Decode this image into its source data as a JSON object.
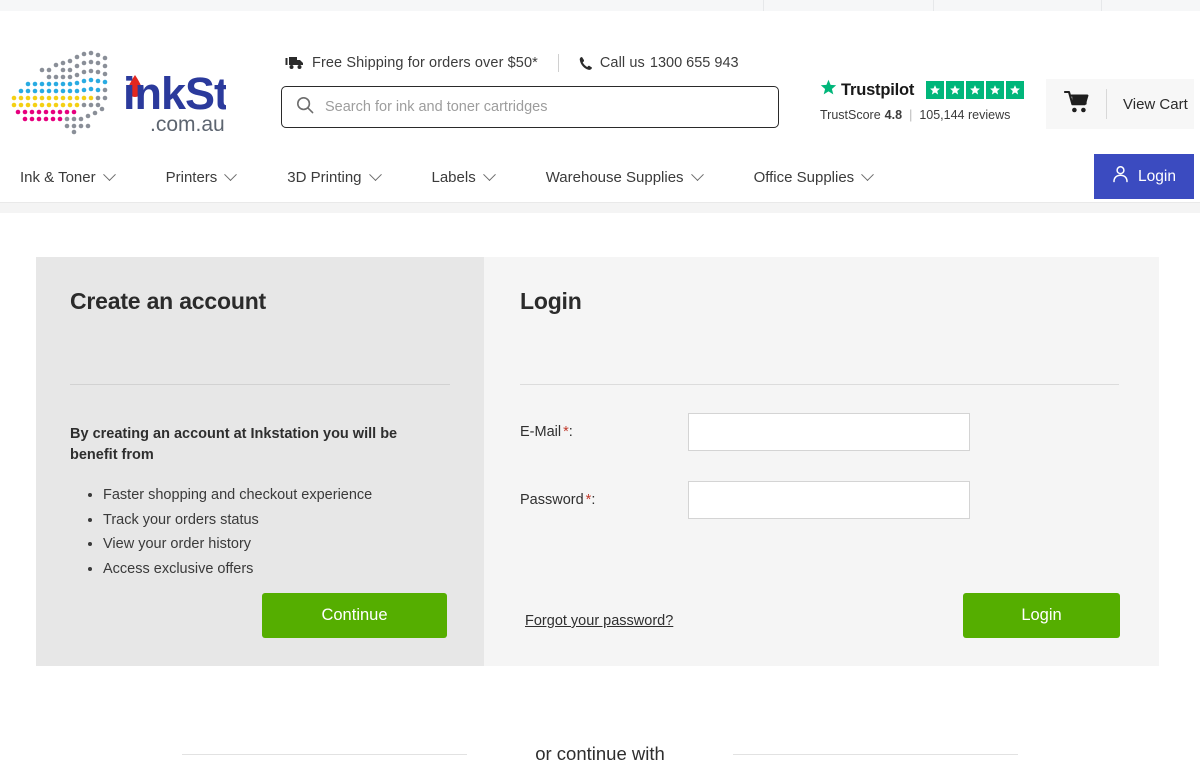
{
  "top_strip": {
    "segments": 4
  },
  "header": {
    "logo": {
      "name": "inkstation-logo",
      "text_ink": "ink",
      "text_station": "Station",
      "text_domain": ".com.au"
    },
    "shipping": {
      "icon": "truck-icon",
      "text": "Free Shipping for orders over $50*"
    },
    "phone": {
      "icon": "phone-icon",
      "label": "Call us",
      "number": "1300 655 943"
    },
    "search": {
      "icon": "search-icon",
      "placeholder": "Search for ink and toner cartridges",
      "value": ""
    },
    "trustpilot": {
      "name": "Trustpilot",
      "stars": 5,
      "star_color": "#00b67a",
      "score_label": "TrustScore",
      "score_value": "4.8",
      "divider": "|",
      "reviews": "105,144 reviews"
    },
    "cart": {
      "icon": "shopping-cart-icon",
      "label": "View Cart"
    }
  },
  "nav": {
    "items": [
      {
        "label": "Ink & Toner",
        "has_dropdown": true
      },
      {
        "label": "Printers",
        "has_dropdown": true
      },
      {
        "label": "3D Printing",
        "has_dropdown": true
      },
      {
        "label": "Labels",
        "has_dropdown": true
      },
      {
        "label": "Warehouse Supplies",
        "has_dropdown": true
      },
      {
        "label": "Office Supplies",
        "has_dropdown": true
      }
    ],
    "login_button": {
      "label": "Login",
      "icon": "user-icon",
      "color": "#3b4bc0"
    }
  },
  "main": {
    "create_account": {
      "title": "Create an account",
      "subtitle": "By creating an account at Inkstation you will be benefit from",
      "benefits": [
        "Faster shopping and checkout experience",
        "Track your orders status",
        "View your order history",
        "Access exclusive offers"
      ],
      "continue_button": "Continue"
    },
    "login": {
      "title": "Login",
      "fields": [
        {
          "label": "E-Mail",
          "required": "*",
          "colon": ":",
          "value": "",
          "type": "email"
        },
        {
          "label": "Password",
          "required": "*",
          "colon": ":",
          "value": "",
          "type": "password"
        }
      ],
      "forgot_link": "Forgot your password?",
      "login_button": "Login"
    },
    "continue_with": {
      "text": "or continue with"
    }
  },
  "colors": {
    "green_button": "#55ae00",
    "login_blue": "#3b4bc0",
    "trustpilot_green": "#00b67a",
    "required_red": "#c0392b",
    "panel_left_bg": "#e7e7e7",
    "panel_right_bg": "#f5f5f5"
  }
}
